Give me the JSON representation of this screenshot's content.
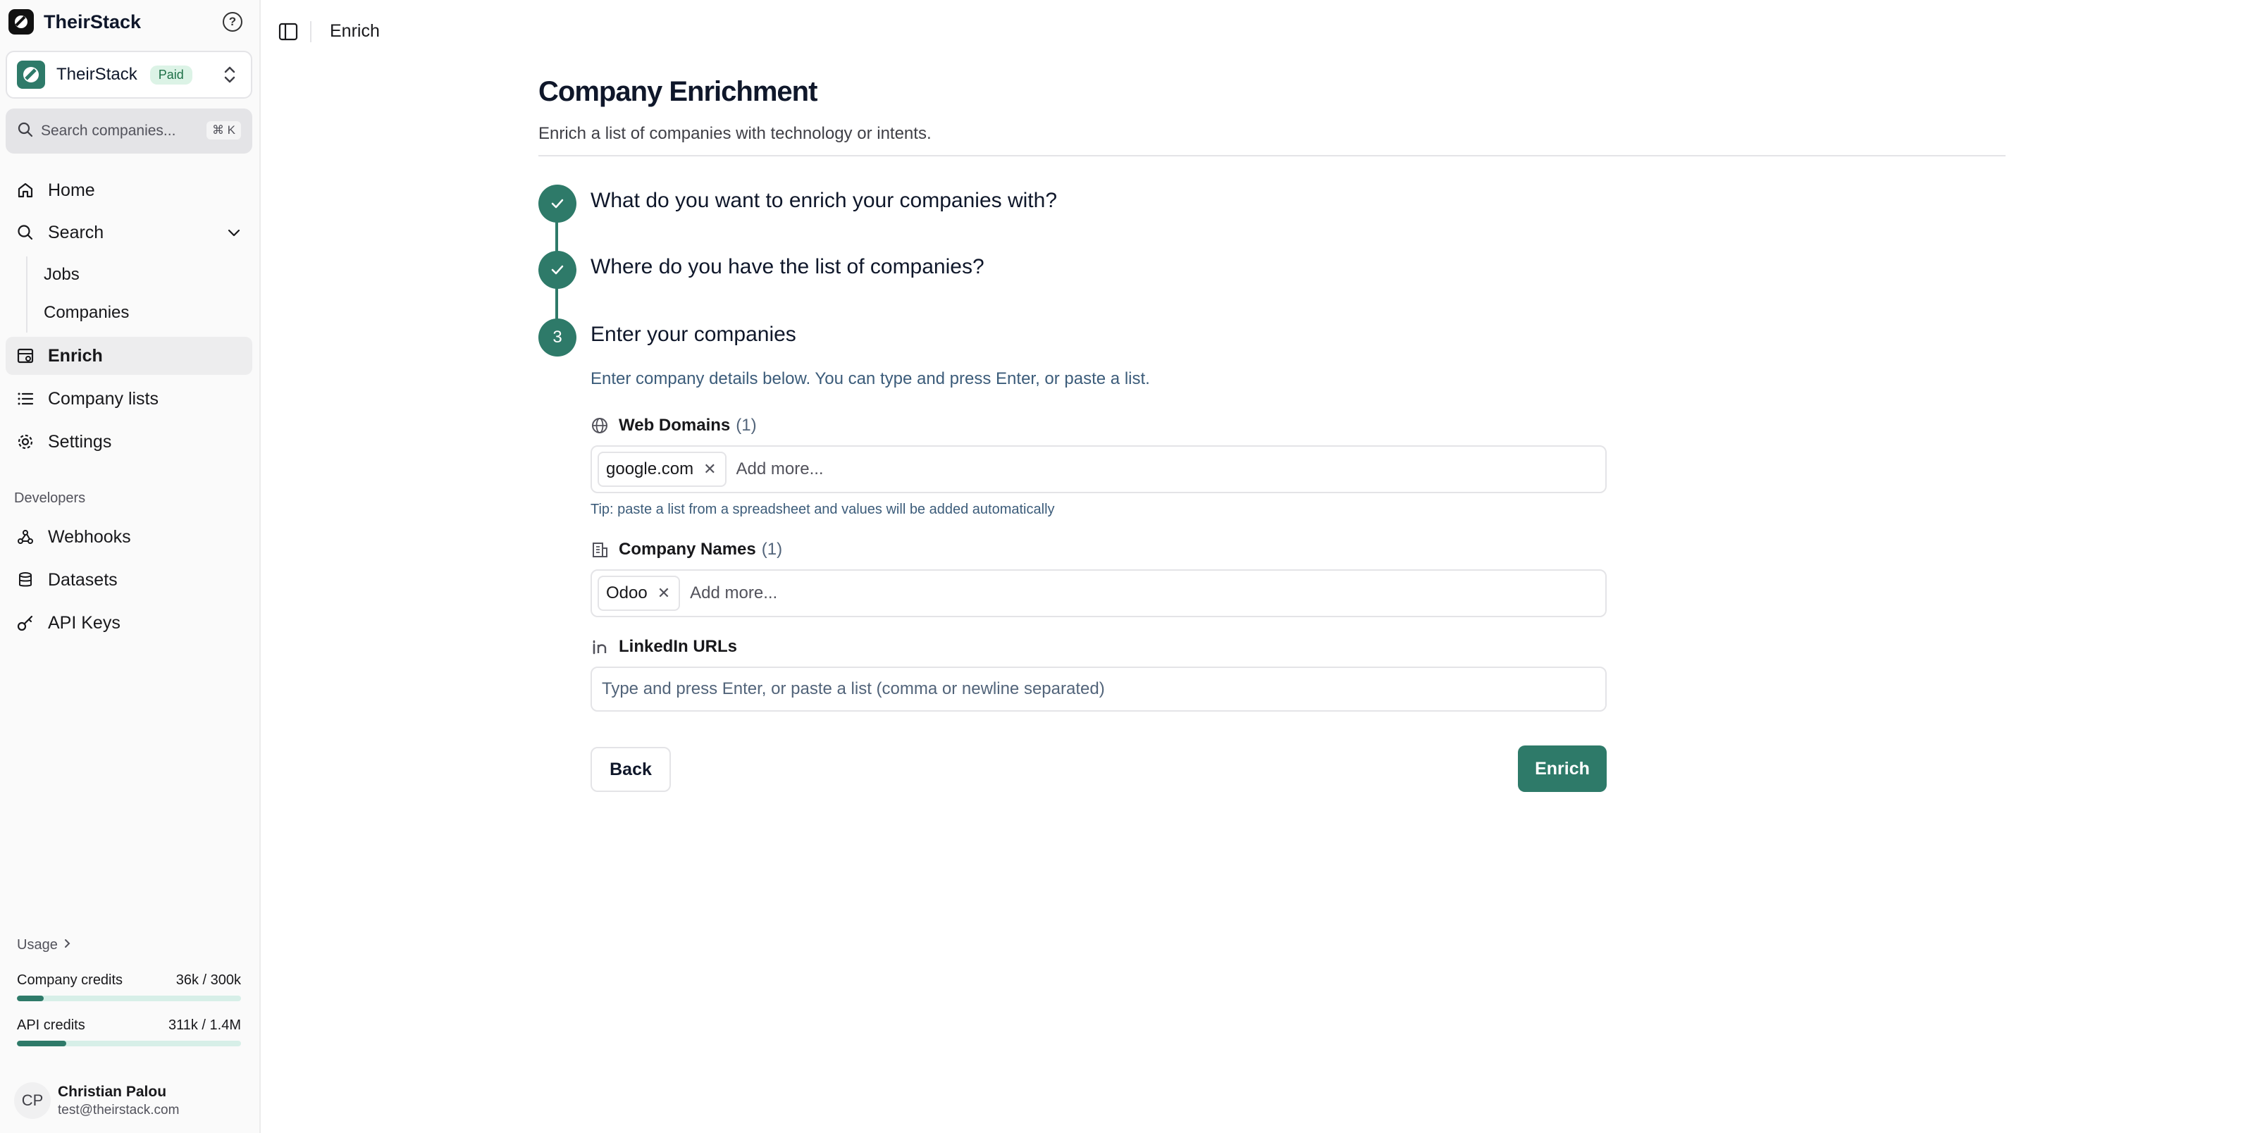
{
  "brand": {
    "name": "TheirStack"
  },
  "workspace": {
    "name": "TheirStack",
    "badge": "Paid"
  },
  "search": {
    "placeholder": "Search companies...",
    "shortcut": "⌘ K"
  },
  "nav": {
    "home": "Home",
    "search": "Search",
    "search_children": [
      "Jobs",
      "Companies"
    ],
    "enrich": "Enrich",
    "company_lists": "Company lists",
    "settings": "Settings",
    "developers_label": "Developers",
    "webhooks": "Webhooks",
    "datasets": "Datasets",
    "api_keys": "API Keys"
  },
  "usage": {
    "label": "Usage",
    "credits": [
      {
        "label": "Company credits",
        "value": "36k / 300k",
        "fill_percent": 12
      },
      {
        "label": "API credits",
        "value": "311k / 1.4M",
        "fill_percent": 22
      }
    ]
  },
  "user": {
    "initials": "CP",
    "name": "Christian Palou",
    "email": "test@theirstack.com"
  },
  "topbar": {
    "breadcrumb": "Enrich"
  },
  "page": {
    "title": "Company Enrichment",
    "subtitle": "Enrich a list of companies with technology or intents."
  },
  "steps": [
    {
      "marker": "check",
      "title": "What do you want to enrich your companies with?"
    },
    {
      "marker": "check",
      "title": "Where do you have the list of companies?"
    },
    {
      "marker": "3",
      "title": "Enter your companies",
      "description": "Enter company details below. You can type and press Enter, or paste a list."
    }
  ],
  "fields": {
    "web_domains": {
      "label": "Web Domains",
      "count": "(1)",
      "chips": [
        "google.com"
      ],
      "placeholder": "Add more...",
      "tip": "Tip: paste a list from a spreadsheet and values will be added automatically"
    },
    "company_names": {
      "label": "Company Names",
      "count": "(1)",
      "chips": [
        "Odoo"
      ],
      "placeholder": "Add more..."
    },
    "linkedin_urls": {
      "label": "LinkedIn URLs",
      "placeholder": "Type and press Enter, or paste a list (comma or newline separated)"
    }
  },
  "actions": {
    "back": "Back",
    "enrich": "Enrich"
  },
  "colors": {
    "accent": "#2e7a69",
    "paid_badge_bg": "#dcf3e6",
    "sidebar_bg": "#fafafa"
  }
}
